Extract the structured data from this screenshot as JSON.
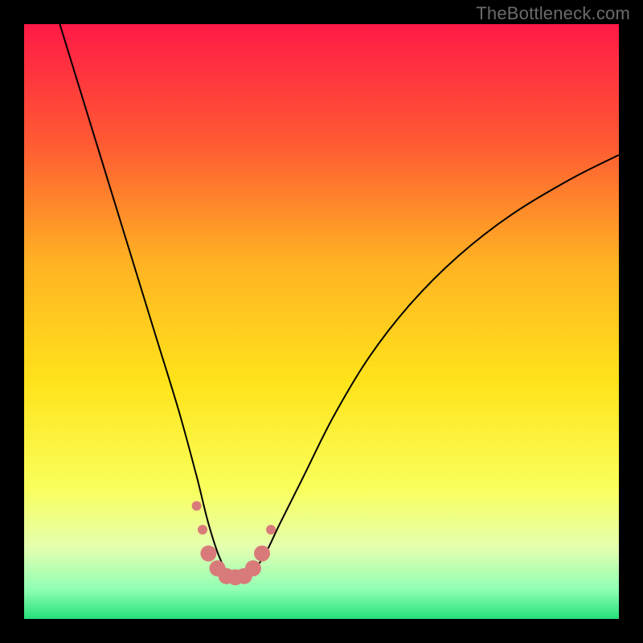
{
  "watermark": "TheBottleneck.com",
  "chart_data": {
    "type": "line",
    "title": "",
    "xlabel": "",
    "ylabel": "",
    "xlim": [
      0,
      100
    ],
    "ylim": [
      0,
      100
    ],
    "grid": false,
    "legend": false,
    "background_gradient": {
      "stops": [
        {
          "offset": 0.0,
          "color": "#ff1a46"
        },
        {
          "offset": 0.2,
          "color": "#ff5a33"
        },
        {
          "offset": 0.4,
          "color": "#ffb223"
        },
        {
          "offset": 0.6,
          "color": "#ffe31a"
        },
        {
          "offset": 0.78,
          "color": "#f9ff5b"
        },
        {
          "offset": 0.88,
          "color": "#e4ffb0"
        },
        {
          "offset": 0.95,
          "color": "#90ffb4"
        },
        {
          "offset": 1.0,
          "color": "#26e07a"
        }
      ]
    },
    "series": [
      {
        "name": "bottleneck-curve",
        "stroke": "#000000",
        "stroke_width": 2,
        "x": [
          6,
          10,
          14,
          18,
          22,
          26,
          29,
          31,
          33,
          35,
          37,
          40,
          43,
          47,
          52,
          58,
          65,
          73,
          82,
          92,
          100
        ],
        "values": [
          100,
          87,
          74,
          61,
          48,
          35,
          24,
          16,
          10,
          7,
          7,
          10,
          16,
          24,
          34,
          44,
          53,
          61,
          68,
          74,
          78
        ]
      }
    ],
    "markers": {
      "name": "optimal-range-markers",
      "color": "#d97a7a",
      "radius_small": 6,
      "radius_large": 10,
      "points": [
        {
          "x": 29.0,
          "y": 19,
          "r": "small"
        },
        {
          "x": 30.0,
          "y": 15,
          "r": "small"
        },
        {
          "x": 31.0,
          "y": 11,
          "r": "large"
        },
        {
          "x": 32.5,
          "y": 8.5,
          "r": "large"
        },
        {
          "x": 34.0,
          "y": 7.2,
          "r": "large"
        },
        {
          "x": 35.5,
          "y": 7.0,
          "r": "large"
        },
        {
          "x": 37.0,
          "y": 7.2,
          "r": "large"
        },
        {
          "x": 38.5,
          "y": 8.5,
          "r": "large"
        },
        {
          "x": 40.0,
          "y": 11,
          "r": "large"
        },
        {
          "x": 41.5,
          "y": 15,
          "r": "small"
        }
      ]
    }
  }
}
